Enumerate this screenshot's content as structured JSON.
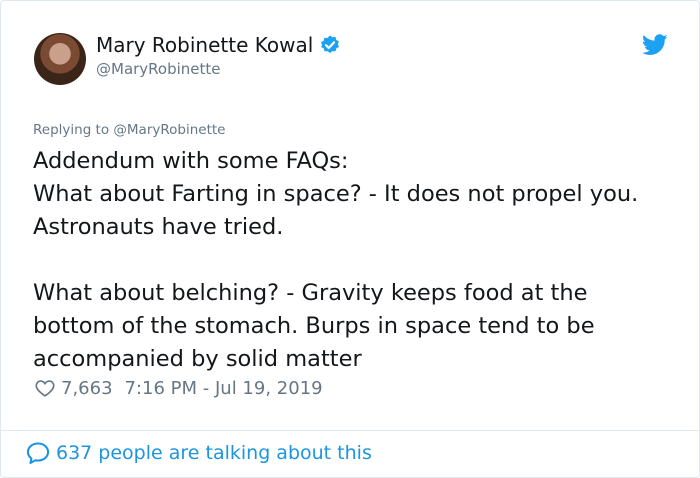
{
  "author": {
    "name": "Mary Robinette Kowal",
    "handle": "@MaryRobinette",
    "verified": true
  },
  "reply": {
    "prefix": "Replying to",
    "handle": "@MaryRobinette"
  },
  "tweet_text": "Addendum with some FAQs:\nWhat about Farting in space? - It does not propel you. Astronauts have tried.\n\nWhat about belching? - Gravity keeps food at the bottom of the stomach. Burps in space tend to be accompanied by solid matter",
  "meta": {
    "likes": "7,663",
    "timestamp": "7:16 PM - Jul 19, 2019"
  },
  "footer": {
    "talking": "637 people are talking about this"
  },
  "icons": {
    "verified": "verified-badge-icon",
    "brand": "twitter-bird-icon",
    "like": "heart-icon",
    "reply": "speech-bubble-icon"
  },
  "colors": {
    "accent": "#1da1f2",
    "link": "#1b95e0",
    "text": "#14171a",
    "muted": "#657786",
    "border": "#e1e8ed"
  }
}
